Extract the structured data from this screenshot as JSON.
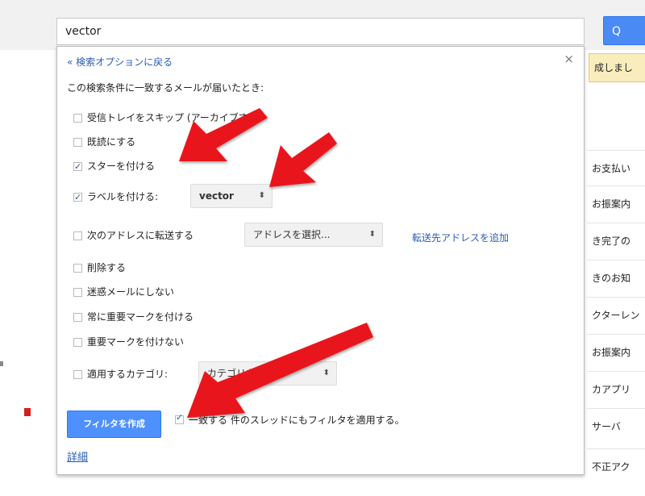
{
  "search": {
    "value": "vector",
    "button_label": "Q"
  },
  "notice": {
    "text": "成しまし"
  },
  "mail_rows": [
    "お支払い",
    "お振案内",
    "き完了の",
    "きのお知",
    "クターレン",
    "お振案内",
    "カアプリ",
    "サーバ",
    "不正アク"
  ],
  "panel": {
    "back_link": "« 検索オプションに戻る",
    "close": "×",
    "description": "この検索条件に一致するメールが届いたとき:",
    "options": [
      {
        "label": "受信トレイをスキップ (アーカイブする)",
        "checked": false
      },
      {
        "label": "既読にする",
        "checked": false
      },
      {
        "label": "スターを付ける",
        "checked": true
      },
      {
        "label": "ラベルを付ける:",
        "checked": true
      },
      {
        "label": "次のアドレスに転送する",
        "checked": false
      },
      {
        "label": "削除する",
        "checked": false
      },
      {
        "label": "迷惑メールにしない",
        "checked": false
      },
      {
        "label": "常に重要マークを付ける",
        "checked": false
      },
      {
        "label": "重要マークを付けない",
        "checked": false
      },
      {
        "label": "適用するカテゴリ:",
        "checked": false
      }
    ],
    "label_dropdown": "vector",
    "address_dropdown": "アドレスを選択...",
    "category_dropdown": "カテゴリを選択...",
    "forward_link": "転送先アドレスを追加",
    "create_button": "フィルタを作成",
    "apply_label": "一致する 件のスレッドにもフィルタを適用する。",
    "apply_checked": true,
    "detail_link": "詳細"
  },
  "colors": {
    "accent": "#4d90fe",
    "link": "#2a5db0",
    "annotation_arrow": "#e8131a"
  }
}
